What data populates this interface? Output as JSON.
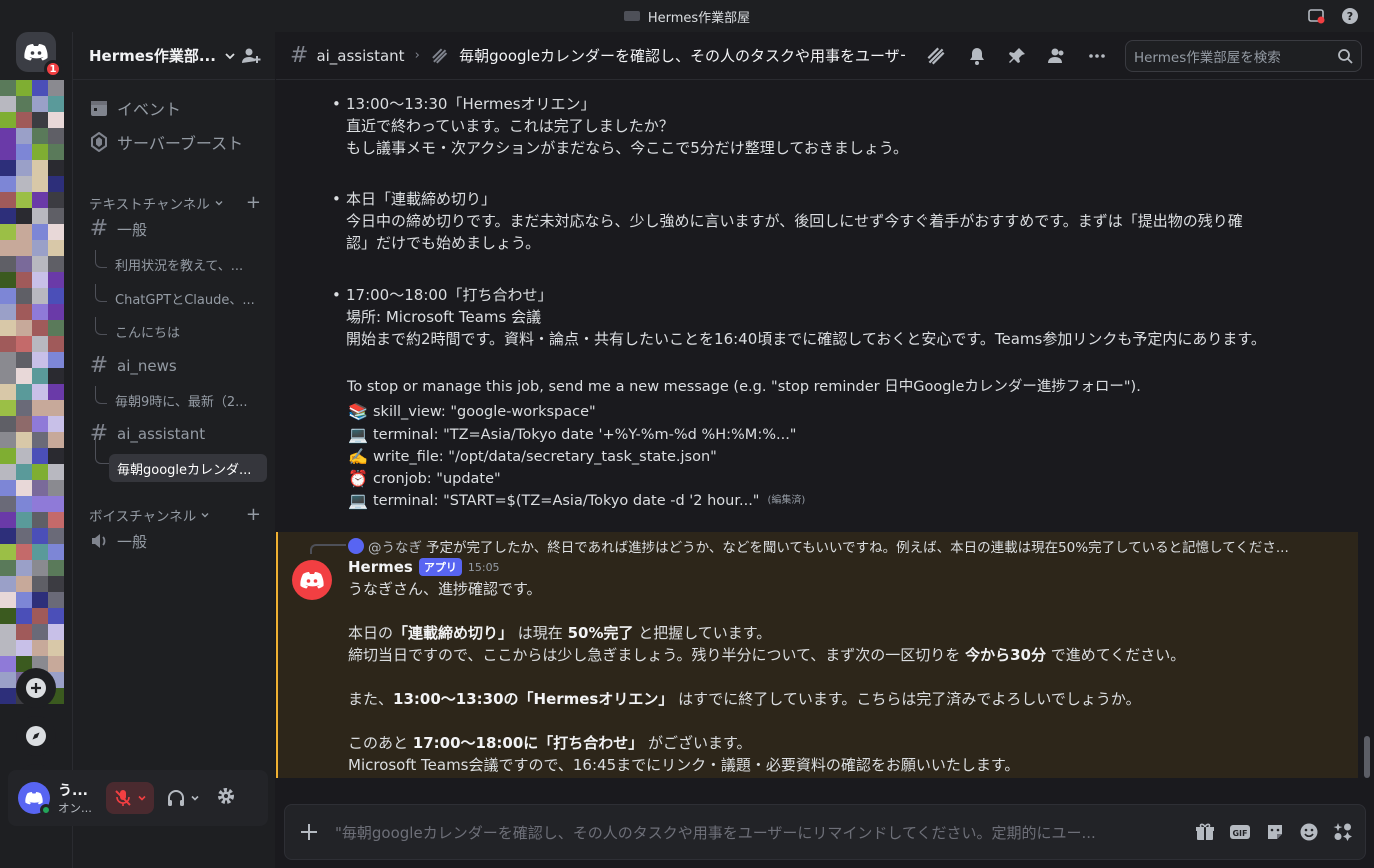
{
  "titlebar": {
    "title": "Hermes作業部屋"
  },
  "guilds": {
    "home_badge": "1"
  },
  "server": {
    "name": "Hermes作業部..."
  },
  "nav": {
    "events": "イベント",
    "boost": "サーバーブースト"
  },
  "categories": {
    "text": "テキストチャンネル",
    "voice": "ボイスチャンネル"
  },
  "channels": {
    "general": "一般",
    "general_threads": [
      "利用状況を教えて、...",
      "ChatGPTとClaude、...",
      "こんにちは"
    ],
    "ai_news": "ai_news",
    "ai_news_threads": [
      "毎朝9時に、最新（2..."
    ],
    "ai_assistant": "ai_assistant",
    "ai_assistant_threads": [
      "毎朝googleカレンダ..."
    ],
    "voice_general": "一般"
  },
  "user": {
    "name": "う...",
    "status": "オン..."
  },
  "header": {
    "channel": "ai_assistant",
    "thread": "毎朝googleカレンダーを確認し、その人のタスクや用事をユーザーにリマインドしてください。",
    "search_placeholder": "Hermes作業部屋を検索"
  },
  "history": {
    "item1": {
      "title": "13:00〜13:30「Hermesオリエン」",
      "l2": "直近で終わっています。これは完了しましたか？",
      "l3": "もし議事メモ・次アクションがまだなら、今ここで5分だけ整理しておきましょう。"
    },
    "item2": {
      "title": "本日「連載締め切り」",
      "l2": "今日中の締め切りです。まだ未対応なら、少し強めに言いますが、後回しにせず今すぐ着手がおすすめです。まずは「提出物の残り確",
      "l3": "認」だけでも始めましょう。"
    },
    "item3": {
      "title": "17:00〜18:00「打ち合わせ」",
      "l2": "場所: Microsoft Teams 会議",
      "l3": "開始まで約2時間です。資料・論点・共有したいことを16:40頃までに確認しておくと安心です。Teams参加リンクも予定内にあります。"
    },
    "stop": "To stop or manage this job, send me a new message (e.g. \"stop reminder 日中Googleカレンダー進捗フォロー\").",
    "tools": [
      {
        "icon": "📚",
        "text": "skill_view: \"google-workspace\""
      },
      {
        "icon": "💻",
        "text": "terminal: \"TZ=Asia/Tokyo date '+%Y-%m-%d %H:%M:%...\""
      },
      {
        "icon": "✍️",
        "text": "write_file: \"/opt/data/secretary_task_state.json\""
      },
      {
        "icon": "⏰",
        "text": "cronjob: \"update\""
      },
      {
        "icon": "💻",
        "text": "terminal: \"START=$(TZ=Asia/Tokyo date -d '2 hour...\""
      }
    ],
    "edited": "(編集済)"
  },
  "reply": {
    "mention": "@うなぎ",
    "text": "予定が完了したか、終日であれば進捗はどうか、などを聞いてもいいですね。例えば、本日の連載は現在50%完了していると記憶してくださ..."
  },
  "message": {
    "author": "Hermes",
    "tag": "アプリ",
    "time": "15:05",
    "l1": "うなぎさん、進捗確認です。",
    "l2a": "本日の",
    "l2b": "「連載締め切り」",
    "l2c": " は現在 ",
    "l2d": "50%完了",
    "l2e": " と把握しています。",
    "l3a": "締切当日ですので、ここからは少し急ぎましょう。残り半分について、まず次の一区切りを ",
    "l3b": "今から30分",
    "l3c": " で進めてください。",
    "l4a": "また、",
    "l4b": "13:00〜13:30の「Hermesオリエン」",
    "l4c": " はすでに終了しています。こちらは完了済みでよろしいでしょうか。",
    "l5a": "このあと ",
    "l5b": "17:00〜18:00に「打ち合わせ」",
    "l5c": " がございます。",
    "l6": "Microsoft Teams会議ですので、16:45までにリンク・議題・必要資料の確認をお願いいたします。"
  },
  "composer": {
    "placeholder": "\"毎朝googleカレンダーを確認し、その人のタスクや用事をユーザーにリマインドしてください。定期的にユー..."
  },
  "colors": {
    "accent": "#5865f2",
    "highlight_border": "#f0b132",
    "danger": "#f23f42",
    "online": "#23a55a"
  }
}
